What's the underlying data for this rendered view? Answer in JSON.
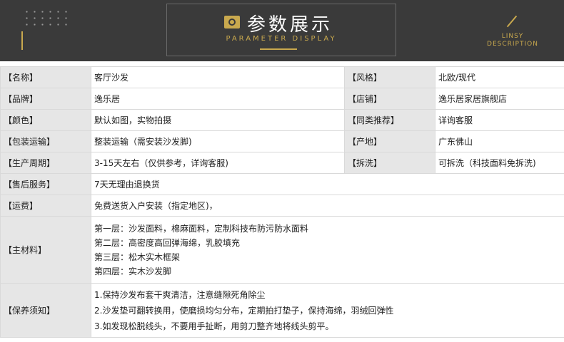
{
  "header": {
    "title_cn": "参数展示",
    "title_en": "PARAMETER DISPLAY",
    "side_label_line1": "LINSY",
    "side_label_line2": "DESCRIPTION"
  },
  "params": {
    "name_label": "【名称】",
    "name_value": "客厅沙发",
    "style_label": "【风格】",
    "style_value": "北欧/现代",
    "brand_label": "【品牌】",
    "brand_value": "逸乐居",
    "shop_label": "【店铺】",
    "shop_value": "逸乐居家居旗舰店",
    "color_label": "【颜色】",
    "color_value": "默认如图，实物拍摄",
    "similar_label": "【同类推荐】",
    "similar_value": "详询客服",
    "packing_label": "【包装运输】",
    "packing_value": "整装运输（需安装沙发脚)",
    "origin_label": "【产地】",
    "origin_value": "广东佛山",
    "cycle_label": "【生产周期】",
    "cycle_value": "3-15天左右（仅供参考，详询客服)",
    "wash_label": "【拆洗】",
    "wash_value": "可拆洗（科技面料免拆洗)",
    "aftersale_label": "【售后服务】",
    "aftersale_value": "7天无理由退换货",
    "freight_label": "【运费】",
    "freight_value": "免费送货入户安装（指定地区)，",
    "material_label": "【主材料】",
    "material_lines": [
      "第一层：沙发面料，棉麻面料，定制科技布防污防水面料",
      "第二层：高密度高回弹海绵，乳胶填充",
      "第三层：松木实木框架",
      "第四层：实木沙发脚"
    ],
    "care_label": "【保养须知】",
    "care_lines": [
      "1.保持沙发布套干爽清洁，注意缝隙死角除尘",
      "2.沙发垫可翻转换用，使磨损均匀分布，定期拍打垫子，保持海绵，羽绒回弹性",
      "3.如发现松脱线头，不要用手扯断，用剪刀整齐地将线头剪平。"
    ]
  },
  "colors": {
    "banner_bg": "#3a3a3a",
    "accent_gold": "#c9a94e",
    "label_bg": "#e6e6e6",
    "border": "#d9d9d9"
  },
  "icons": {
    "title_icon": "camera-icon"
  }
}
